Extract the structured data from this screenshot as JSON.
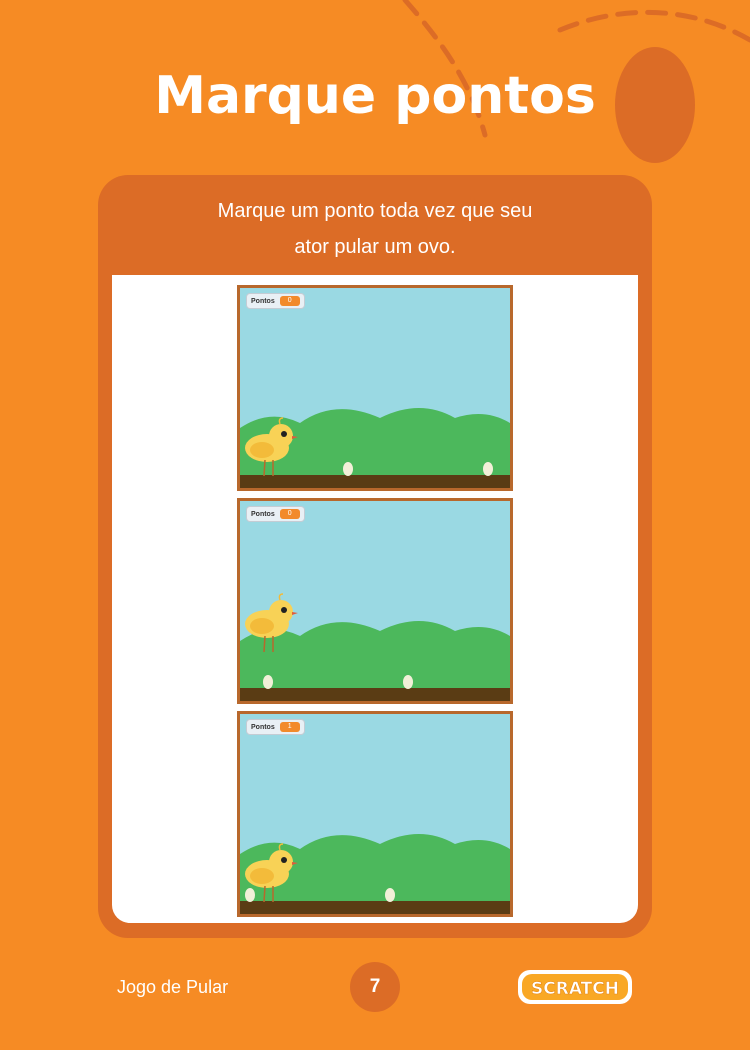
{
  "page": {
    "title": "Marque pontos",
    "instruction_line1": "Marque um ponto toda vez que seu",
    "instruction_line2": "ator pular um ovo."
  },
  "stages": [
    {
      "monitor_label": "Pontos",
      "monitor_value": "0"
    },
    {
      "monitor_label": "Pontos",
      "monitor_value": "0"
    },
    {
      "monitor_label": "Pontos",
      "monitor_value": "1"
    }
  ],
  "footer": {
    "project_name": "Jogo de Pular",
    "page_number": "7",
    "logo_text": "SCRATCH"
  },
  "colors": {
    "background": "#f68b24",
    "card": "#dc6c26",
    "sky": "#9ad9e3",
    "bushes": "#4cb85c",
    "ground": "#5a3c14"
  }
}
